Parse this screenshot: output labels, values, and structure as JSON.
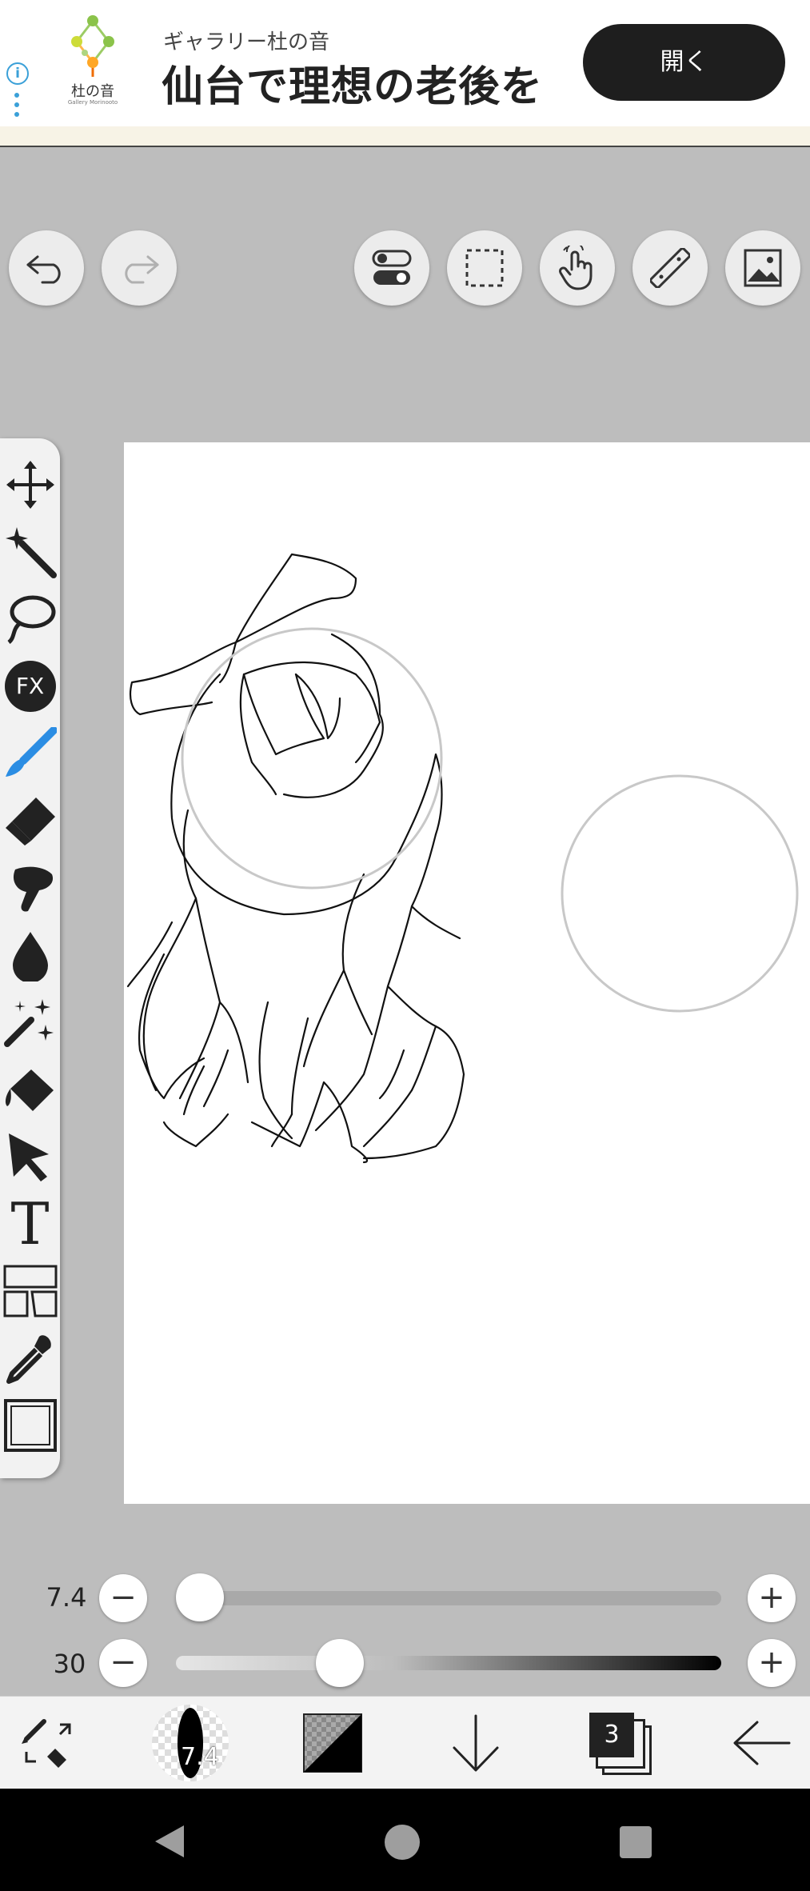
{
  "ad": {
    "subtitle": "ギャラリー杜の音",
    "title": "仙台で理想の老後を",
    "button": "開く",
    "logo_text": "杜の音",
    "logo_sub": "Gallery Morinooto",
    "info_icon": "i"
  },
  "toolbar": {
    "undo": "undo-icon",
    "redo": "redo-icon",
    "toggle": "toggle-icon",
    "selection": "selection-icon",
    "hand": "hand-icon",
    "ruler": "ruler-icon",
    "image": "image-icon"
  },
  "tools": [
    "move-icon",
    "magic-wand-icon",
    "lasso-icon",
    "fx-icon",
    "brush-icon",
    "eraser-icon",
    "smudge-icon",
    "blur-icon",
    "sparkle-brush-icon",
    "fill-icon",
    "select-arrow-icon",
    "text-icon",
    "panel-icon",
    "eyedropper-icon",
    "canvas-icon"
  ],
  "tool_fx_label": "FX",
  "tool_text_label": "T",
  "sliders": {
    "size": {
      "value": "7.4",
      "level": 0.01
    },
    "opacity": {
      "value": "30",
      "level": 0.3
    }
  },
  "bottom": {
    "brush_size": "7.4",
    "layers_count": "3"
  },
  "colors": {
    "accent": "#2b8de3",
    "background": "#bdbdbd",
    "button_dark": "#1e1e1e"
  }
}
